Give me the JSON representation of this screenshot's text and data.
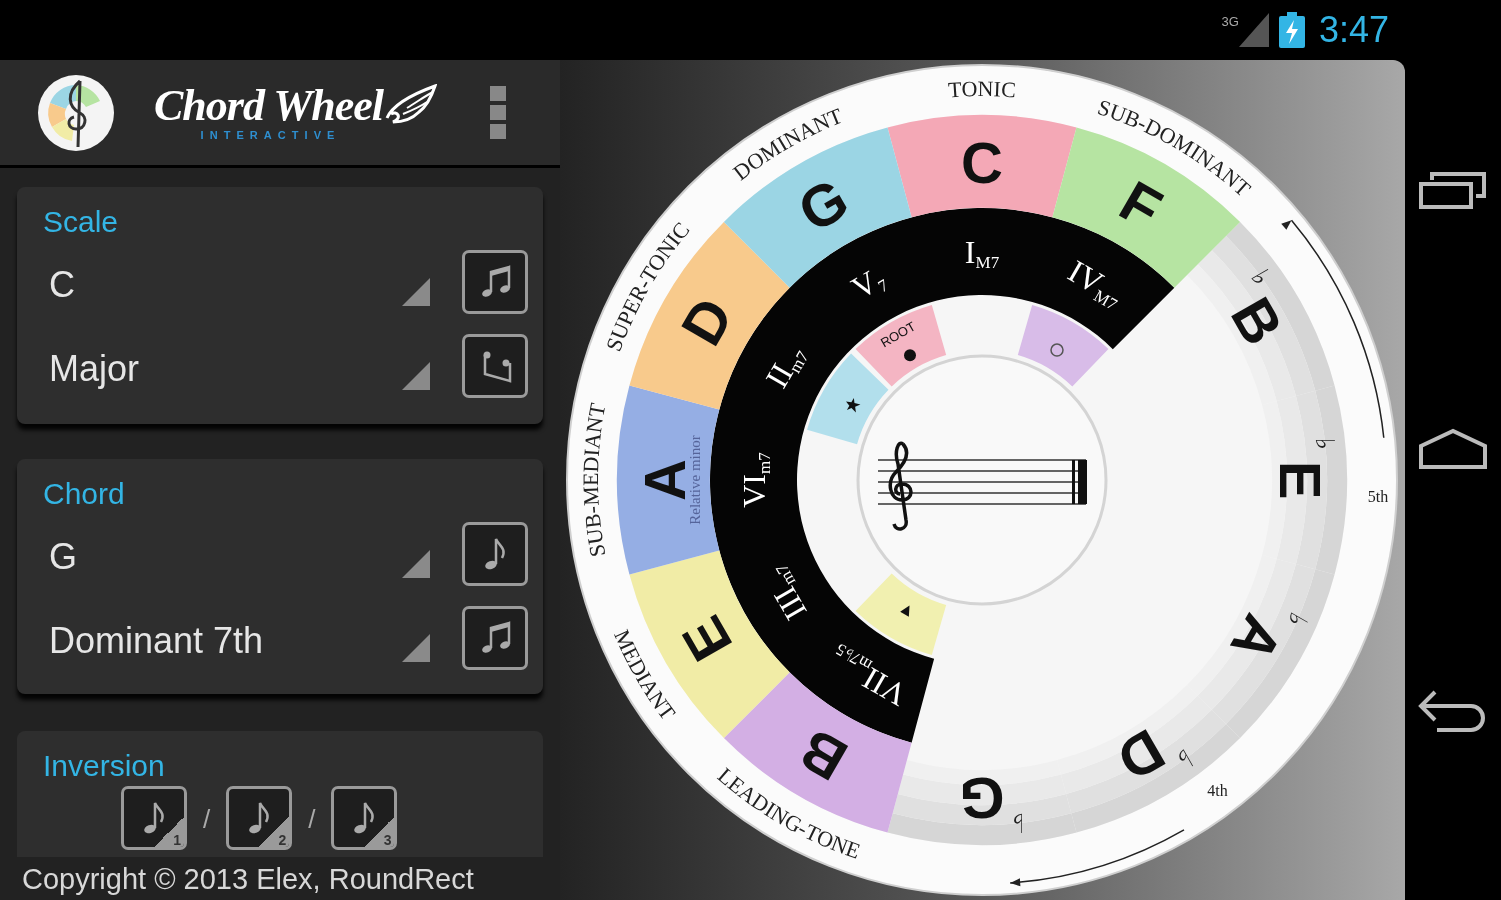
{
  "status_bar": {
    "network": "3G",
    "time": "3:47"
  },
  "app_bar": {
    "title": "Chord Wheel",
    "subtitle": "INTERACTIVE"
  },
  "scale": {
    "title": "Scale",
    "key": "C",
    "mode": "Major"
  },
  "chord": {
    "title": "Chord",
    "root": "G",
    "type": "Dominant 7th"
  },
  "inversion": {
    "title": "Inversion",
    "options": [
      {
        "number": "1"
      },
      {
        "number": "2"
      },
      {
        "number": "3"
      }
    ],
    "separators": [
      "/",
      "/"
    ]
  },
  "copyright": "Copyright © 2013 Elex, RoundRect",
  "wheel": {
    "relative_minor_label": "Relative minor",
    "interval_labels": [
      "5th",
      "4th"
    ],
    "segments": [
      {
        "note": "C",
        "degree": "TONIC",
        "numeral": "I",
        "quality": "M7",
        "color": "#f4a8b6"
      },
      {
        "note": "F",
        "degree": "SUB-DOMINANT",
        "numeral": "IV",
        "quality": "M7",
        "color": "#b6e4a2",
        "chord_tone": {
          "kind": "circle",
          "color": "#d8bce8"
        }
      },
      {
        "note": "B",
        "accidental": "♭"
      },
      {
        "note": "E",
        "accidental": "♭"
      },
      {
        "note": "A",
        "accidental": "♭"
      },
      {
        "note": "D",
        "accidental": "♭"
      },
      {
        "note": "G",
        "accidental": "♭"
      },
      {
        "note": "B",
        "degree": "LEADING-TONE",
        "numeral": "VII",
        "quality": "m7♭5",
        "color": "#d3afe4",
        "chord_tone": {
          "kind": "triangle",
          "color": "#f1f0b0"
        }
      },
      {
        "note": "E",
        "degree": "MEDIANT",
        "numeral": "III",
        "quality": "m7",
        "color": "#f1eca6"
      },
      {
        "note": "A",
        "degree": "SUB-MEDIANT",
        "numeral": "VI",
        "quality": "m7",
        "color": "#95aee4"
      },
      {
        "note": "D",
        "degree": "SUPER-TONIC",
        "numeral": "II",
        "quality": "m7",
        "color": "#f8ca8c",
        "chord_tone": {
          "kind": "star",
          "color": "#b2dfec"
        }
      },
      {
        "note": "G",
        "degree": "DOMINANT",
        "numeral": "V",
        "quality": "7",
        "color": "#9bd5e4",
        "chord_tone": {
          "kind": "root",
          "label": "ROOT",
          "color": "#f4b5c3"
        }
      }
    ]
  }
}
